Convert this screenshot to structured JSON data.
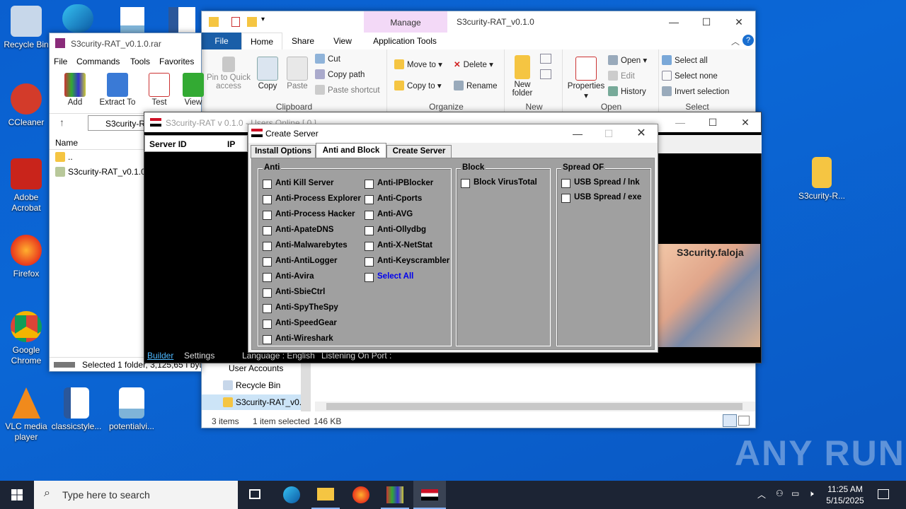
{
  "desktop": {
    "icons": [
      {
        "label": "Recycle Bin",
        "color": "#c7d7ea"
      },
      {
        "label": "CCleaner",
        "color": "#d33b2a"
      },
      {
        "label": "Adobe Acrobat",
        "color": "#c9241b"
      },
      {
        "label": "Firefox",
        "color": "#ff7a1a"
      },
      {
        "label": "Google Chrome",
        "color": "#3fa34d"
      },
      {
        "label": "VLC media player",
        "color": "#f08a1c"
      },
      {
        "label": "classicstyle...",
        "color": "#ffffff"
      },
      {
        "label": "potentialvi...",
        "color": "#ffffff"
      },
      {
        "label": "S3curity-R...",
        "color": "#f5c542"
      }
    ]
  },
  "explorer": {
    "title": "S3curity-RAT_v0.1.0",
    "manage_tab": "Manage",
    "tabs": [
      "File",
      "Home",
      "Share",
      "View",
      "Application Tools"
    ],
    "clipboard": {
      "pin": "Pin to Quick access",
      "copy": "Copy",
      "paste": "Paste",
      "cut": "Cut",
      "copy_path": "Copy path",
      "paste_shortcut": "Paste shortcut",
      "label": "Clipboard"
    },
    "organize": {
      "move_to": "Move to",
      "copy_to": "Copy to",
      "delete": "Delete",
      "rename": "Rename",
      "label": "Organize"
    },
    "new": {
      "new_folder": "New folder",
      "label": "New"
    },
    "open": {
      "properties": "Properties",
      "open": "Open",
      "edit": "Edit",
      "history": "History",
      "label": "Open"
    },
    "select": {
      "select_all": "Select all",
      "select_none": "Select none",
      "invert": "Invert selection",
      "label": "Select"
    },
    "nav": [
      "User Accounts",
      "Recycle Bin",
      "S3curity-RAT_v0..."
    ],
    "status_items": "3 items",
    "status_selected": "1 item selected",
    "status_size": "146 KB"
  },
  "winrar": {
    "title": "S3curity-RAT_v0.1.0.rar",
    "menu": [
      "File",
      "Commands",
      "Tools",
      "Favorites"
    ],
    "toolbar": [
      "Add",
      "Extract To",
      "Test",
      "View"
    ],
    "path": "S3curity-RA",
    "col_name": "Name",
    "rows": [
      "..",
      "S3curity-RAT_v0.1.0"
    ],
    "status": "Selected 1 folder, 3,125,65 I byte"
  },
  "rat": {
    "title": "S3curity-RAT v 0.1.0 - Users Online [ 0 ]",
    "col_server": "Server ID",
    "col_ip": "IP",
    "builder": "Builder",
    "settings": "Settings",
    "language": "Language : English",
    "listening": "Listening On Port :",
    "banner": "S3curity.faloja"
  },
  "create": {
    "title": "Create Server",
    "tabs": [
      "Install Options",
      "Anti and Block",
      "Create Server"
    ],
    "anti_title": "Anti",
    "block_title": "Block",
    "spread_title": "Spread OF",
    "anti_col1": [
      "Anti Kill Server",
      "Anti-Process Explorer",
      "Anti-Process Hacker",
      "Anti-ApateDNS",
      "Anti-Malwarebytes",
      "Anti-AntiLogger",
      "Anti-Avira",
      "Anti-SbieCtrl",
      "Anti-SpyTheSpy",
      "Anti-SpeedGear",
      "Anti-Wireshark"
    ],
    "anti_col2": [
      "Anti-IPBlocker",
      "Anti-Cports",
      "Anti-AVG",
      "Anti-Ollydbg",
      "Anti-X-NetStat",
      "Anti-Keyscrambler"
    ],
    "select_all": "Select All",
    "block": [
      "Block VirusTotal"
    ],
    "spread": [
      "USB Spread / lnk",
      "USB Spread / exe"
    ]
  },
  "taskbar": {
    "search_placeholder": "Type here to search",
    "time": "11:25 AM",
    "date": "5/15/2025"
  },
  "watermark": "ANY RUN"
}
